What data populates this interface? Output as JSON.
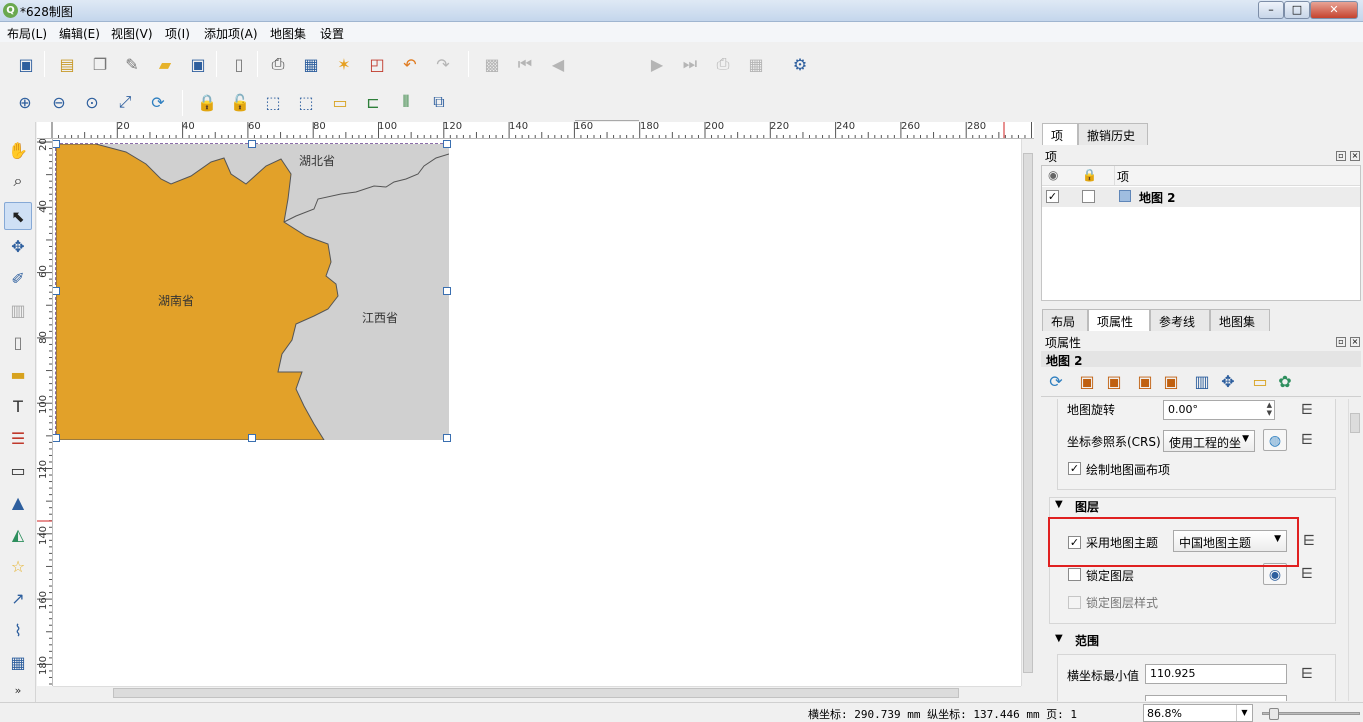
{
  "window": {
    "title": "*628制图",
    "app_icon": "Q"
  },
  "window_controls": {
    "minimize": "–",
    "maximize": "□",
    "close": "✕"
  },
  "menu": [
    "布局(L)",
    "编辑(E)",
    "视图(V)",
    "项(I)",
    "添加项(A)",
    "地图集",
    "设置"
  ],
  "toolbar": {
    "page_value": "1"
  },
  "ruler_top_labels": [
    "20",
    "40",
    "60",
    "80",
    "100",
    "120",
    "140",
    "160",
    "180",
    "200",
    "220",
    "240",
    "260",
    "280"
  ],
  "ruler_left_labels": [
    "20",
    "40",
    "60",
    "80",
    "100",
    "120",
    "140",
    "160",
    "180"
  ],
  "map": {
    "labels": {
      "hubei": "湖北省",
      "hunan": "湖南省",
      "jiangxi": "江西省"
    },
    "colors": {
      "hunan": "#e2a129",
      "other": "#d0d0d0",
      "border": "#555555"
    }
  },
  "status": {
    "coords": "横坐标: 290.739 mm 纵坐标: 137.446 mm 页: 1",
    "zoom": "86.8%"
  },
  "right_panel": {
    "top_tabs": [
      "项",
      "撤销历史"
    ],
    "items_panel_title": "项",
    "items_header": {
      "item_col": "项"
    },
    "items": [
      {
        "name": "地图 2",
        "visible": true,
        "locked": false
      }
    ],
    "bottom_tabs": [
      "布局",
      "项属性",
      "参考线",
      "地图集"
    ],
    "props_panel_title": "项属性",
    "selected_item": "地图 2",
    "props": {
      "rotation_label": "地图旋转",
      "rotation_value": "0.00°",
      "crs_label": "坐标参照系(CRS)",
      "crs_value": "使用工程的坐",
      "draw_items_label": "绘制地图画布项",
      "layers_section": "图层",
      "follow_theme_label": "采用地图主题",
      "theme_value": "中国地图主题",
      "lock_layers_label": "锁定图层",
      "lock_styles_label": "锁定图层样式",
      "extent_section": "范围",
      "xmin_label": "横坐标最小值",
      "xmin_value": "110.925"
    }
  },
  "accent_colors": {
    "highlight": "#e02020",
    "selection_handle": "#3a6fb0"
  }
}
